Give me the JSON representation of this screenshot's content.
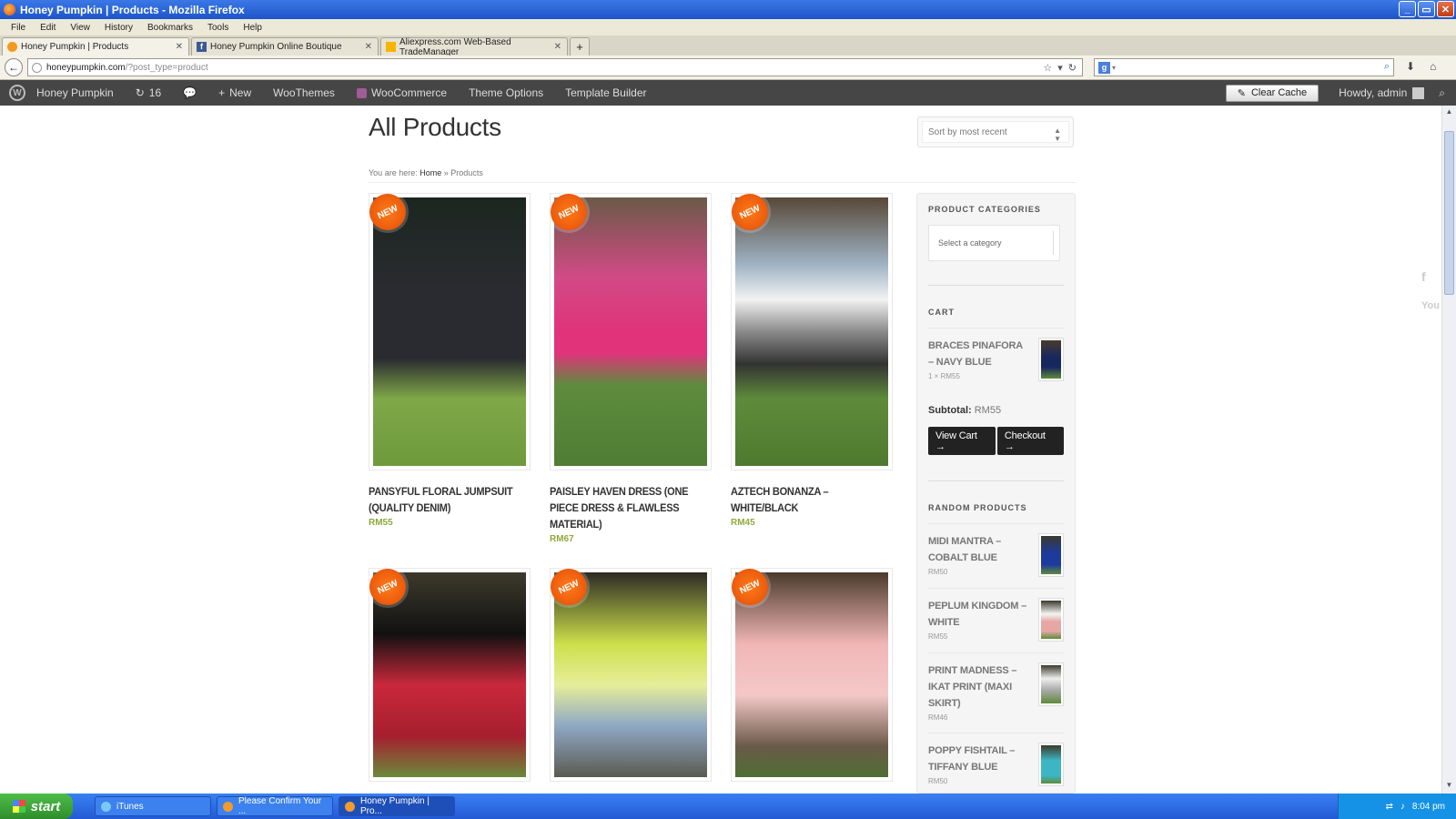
{
  "window": {
    "title": "Honey Pumpkin | Products - Mozilla Firefox"
  },
  "menu": [
    "File",
    "Edit",
    "View",
    "History",
    "Bookmarks",
    "Tools",
    "Help"
  ],
  "tabs": [
    {
      "label": "Honey Pumpkin | Products",
      "active": true,
      "icon": "pumpkin-icon"
    },
    {
      "label": "Honey Pumpkin Online Boutique",
      "active": false,
      "icon": "facebook-icon"
    },
    {
      "label": "Aliexpress.com Web-Based TradeManager",
      "active": false,
      "icon": "aliexpress-icon"
    }
  ],
  "newtab_label": "+",
  "url": {
    "host": "honeypumpkin.com",
    "path": "/?post_type=product"
  },
  "adminbar": {
    "site": "Honey Pumpkin",
    "updates": "16",
    "new": "New",
    "woothemes": "WooThemes",
    "woocommerce": "WooCommerce",
    "theme_options": "Theme Options",
    "template_builder": "Template Builder",
    "clear_cache": "Clear Cache",
    "howdy": "Howdy, admin"
  },
  "page": {
    "title": "All Products",
    "sort": "Sort by most recent",
    "crumb_prefix": "You are here:",
    "crumb_home": "Home",
    "crumb_sep": "»",
    "crumb_current": "Products",
    "badge": "NEW"
  },
  "products": [
    {
      "name": "PANSYFUL FLORAL JUMPSUIT (QUALITY DENIM)",
      "price": "RM55",
      "c1": "#2a2b30",
      "c2": "#7fa848"
    },
    {
      "name": "PAISLEY HAVEN DRESS (ONE PIECE DRESS & FLAWLESS MATERIAL)",
      "price": "RM67",
      "c1": "#e0337a",
      "c2": "#5d8c3e"
    },
    {
      "name": "AZTECH BONANZA – WHITE/BLACK",
      "price": "RM45",
      "c1": "#8a8a8a",
      "c2": "#5e8b3a"
    },
    {
      "name": "",
      "price": "",
      "c1": "#c9283a",
      "c2": "#6a8a3a"
    },
    {
      "name": "",
      "price": "",
      "c1": "#cde04a",
      "c2": "#5a5a50"
    },
    {
      "name": "",
      "price": "",
      "c1": "#f1b6b7",
      "c2": "#6a5a48"
    }
  ],
  "sidebar": {
    "categories_title": "PRODUCT CATEGORIES",
    "category_placeholder": "Select a category",
    "cart_title": "CART",
    "cart_item": {
      "name": "BRACES PINAFORA – NAVY BLUE",
      "qty": "1 × RM55"
    },
    "subtotal_label": "Subtotal:",
    "subtotal_value": "RM55",
    "view_cart": "View Cart →",
    "checkout": "Checkout →",
    "random_title": "RANDOM PRODUCTS",
    "random": [
      {
        "name": "MIDI MANTRA – COBALT BLUE",
        "price": "RM50",
        "color": "#1d3b9c"
      },
      {
        "name": "PEPLUM KINGDOM – WHITE",
        "price": "RM55",
        "color": "#e6a7a4"
      },
      {
        "name": "PRINT MADNESS – IKAT PRINT (MAXI SKIRT)",
        "price": "RM46",
        "color": "#cfcfcf"
      },
      {
        "name": "POPPY FISHTAIL – TIFFANY BLUE",
        "price": "RM50",
        "color": "#3cb6c2"
      }
    ]
  },
  "taskbar": {
    "start": "start",
    "items": [
      {
        "label": "iTunes"
      },
      {
        "label": "Please Confirm Your ..."
      },
      {
        "label": "Honey Pumpkin | Pro..."
      }
    ],
    "clock": "8:04 pm"
  },
  "colors": {
    "accent_price": "#8fa93d",
    "badge": "#ff7a1a",
    "adminbar": "#464646"
  }
}
